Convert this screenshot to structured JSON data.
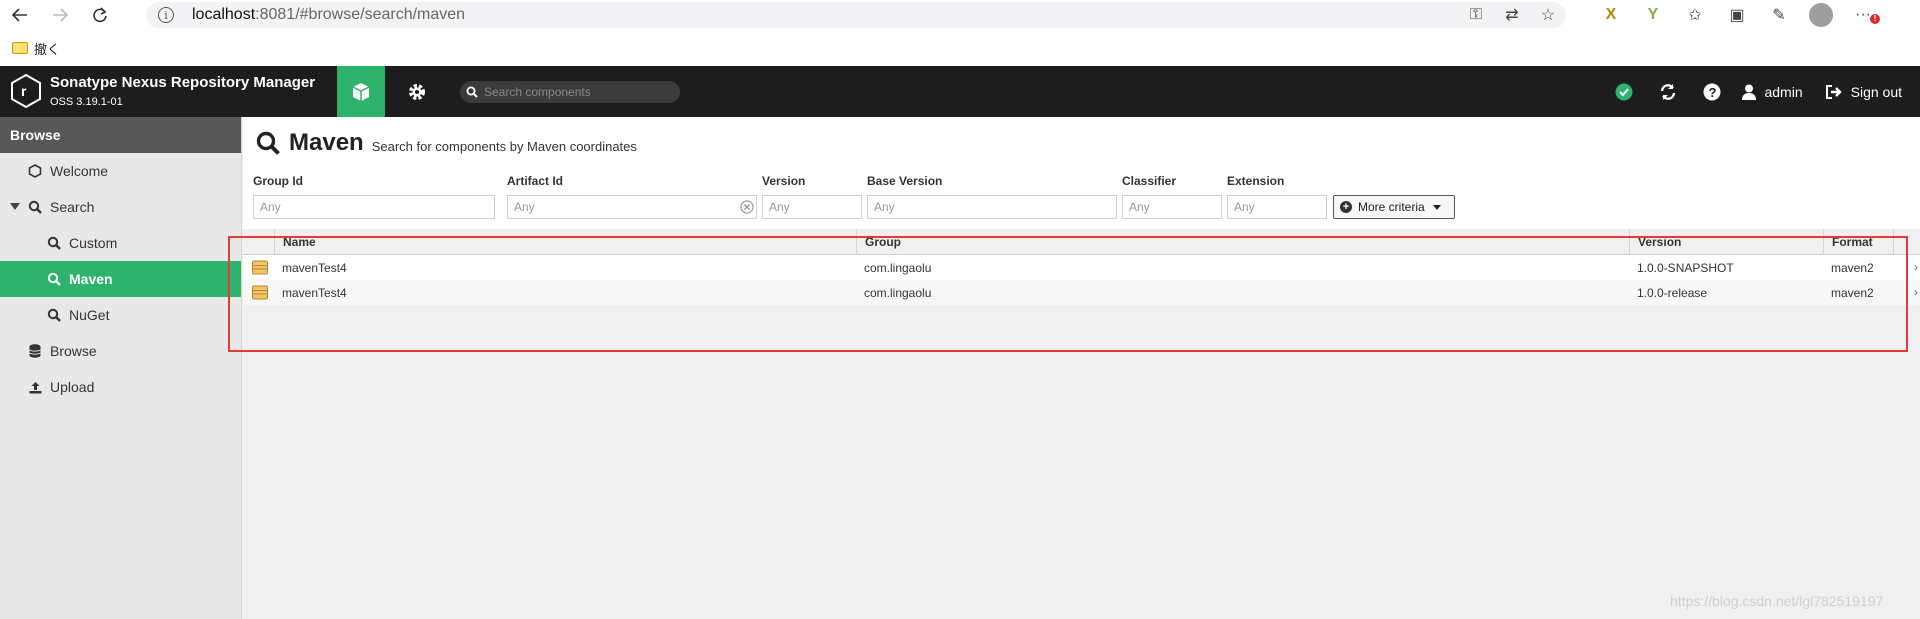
{
  "browser": {
    "url_host": "localhost",
    "url_rest": ":8081/#browse/search/maven",
    "bookmark_label": "撤く"
  },
  "header": {
    "app_title": "Sonatype Nexus Repository Manager",
    "version": "OSS 3.19.1-01",
    "search_placeholder": "Search components",
    "user": "admin",
    "sign_out": "Sign out"
  },
  "sidebar": {
    "title": "Browse",
    "items": [
      {
        "label": "Welcome",
        "icon": "hexagon-icon"
      },
      {
        "label": "Search",
        "icon": "search-icon"
      },
      {
        "label": "Custom",
        "icon": "search-icon"
      },
      {
        "label": "Maven",
        "icon": "search-icon"
      },
      {
        "label": "NuGet",
        "icon": "search-icon"
      },
      {
        "label": "Browse",
        "icon": "database-icon"
      },
      {
        "label": "Upload",
        "icon": "upload-icon"
      }
    ]
  },
  "page": {
    "title": "Maven",
    "subtitle": "Search for components by Maven coordinates"
  },
  "criteria": {
    "group_id": {
      "label": "Group Id",
      "placeholder": "Any"
    },
    "artifact_id": {
      "label": "Artifact Id",
      "placeholder": "Any"
    },
    "version": {
      "label": "Version",
      "placeholder": "Any"
    },
    "base_version": {
      "label": "Base Version",
      "placeholder": "Any"
    },
    "classifier": {
      "label": "Classifier",
      "placeholder": "Any"
    },
    "extension": {
      "label": "Extension",
      "placeholder": "Any"
    },
    "more_criteria": "More criteria"
  },
  "grid": {
    "columns": [
      "Name",
      "Group",
      "Version",
      "Format"
    ],
    "rows": [
      {
        "name": "mavenTest4",
        "group": "com.lingaolu",
        "version": "1.0.0-SNAPSHOT",
        "format": "maven2"
      },
      {
        "name": "mavenTest4",
        "group": "com.lingaolu",
        "version": "1.0.0-release",
        "format": "maven2"
      }
    ]
  },
  "watermark": "https://blog.csdn.net/lgl782519197",
  "colors": {
    "accent": "#2db36b",
    "header_bg": "#1d1d1d",
    "highlight": "#e53935"
  }
}
